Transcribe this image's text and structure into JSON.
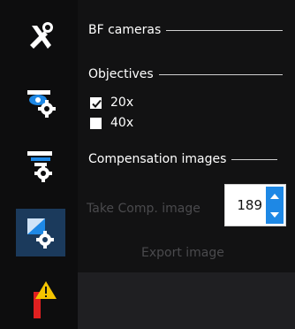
{
  "sidebar": {
    "items": [
      {
        "icon": "tools-icon"
      },
      {
        "icon": "camera-settings-icon"
      },
      {
        "icon": "objective-settings-icon"
      },
      {
        "icon": "image-settings-icon",
        "active": true
      },
      {
        "icon": "warning-icon"
      }
    ]
  },
  "panel": {
    "bf_cameras_title": "BF cameras",
    "objectives_title": "Objectives",
    "objectives": [
      {
        "label": "20x",
        "checked": true
      },
      {
        "label": "40x",
        "checked": false
      }
    ],
    "compensation_title": "Compensation images",
    "take_comp_label": "Take Comp. image",
    "spin_value": "189",
    "export_label": "Export image"
  },
  "colors": {
    "accent": "#1e88e5",
    "active_tab": "#1b3a5c",
    "disabled_text": "#4a4a4d",
    "warning_yellow": "#f4c400",
    "warning_red": "#e02020"
  }
}
